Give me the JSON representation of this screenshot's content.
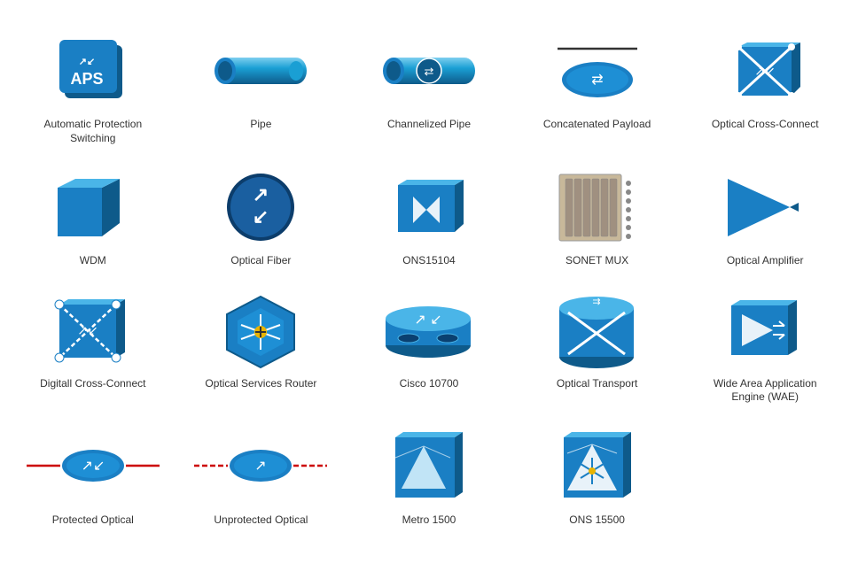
{
  "items": [
    {
      "id": "aps",
      "label": "Automatic Protection\nSwitching"
    },
    {
      "id": "pipe",
      "label": "Pipe"
    },
    {
      "id": "cpipe",
      "label": "Channelized Pipe"
    },
    {
      "id": "concat",
      "label": "Concatenated Payload"
    },
    {
      "id": "occ",
      "label": "Optical Cross-Connect"
    },
    {
      "id": "wdm",
      "label": "WDM"
    },
    {
      "id": "ofib",
      "label": "Optical Fiber"
    },
    {
      "id": "ons15104",
      "label": "ONS15104"
    },
    {
      "id": "sonet",
      "label": "SONET MUX"
    },
    {
      "id": "amp",
      "label": "Optical Amplifier"
    },
    {
      "id": "dcc",
      "label": "Digitall Cross-Connect"
    },
    {
      "id": "osr",
      "label": "Optical Services Router"
    },
    {
      "id": "cisco10700",
      "label": "Cisco 10700"
    },
    {
      "id": "ot",
      "label": "Optical Transport"
    },
    {
      "id": "wae",
      "label": "Wide Area Application\nEngine (WAE)"
    },
    {
      "id": "prot",
      "label": "Protected Optical"
    },
    {
      "id": "unprot",
      "label": "Unprotected Optical"
    },
    {
      "id": "metro",
      "label": "Metro 1500"
    },
    {
      "id": "ons15500",
      "label": "ONS 15500"
    }
  ]
}
